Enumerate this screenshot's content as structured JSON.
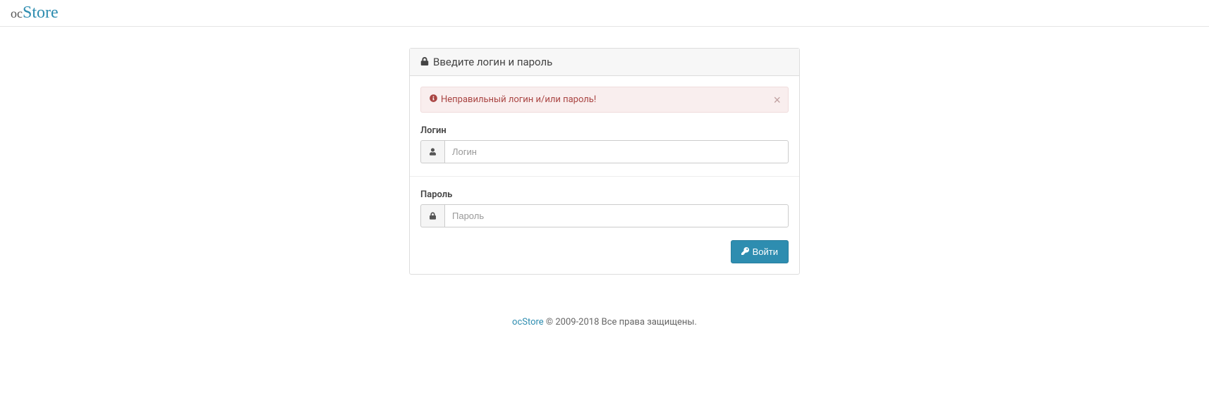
{
  "header": {
    "logo_oc": "oc",
    "logo_store": "Store"
  },
  "panel": {
    "title": "Введите логин и пароль"
  },
  "alert": {
    "message": "Неправильный логин и/или пароль!"
  },
  "form": {
    "login_label": "Логин",
    "login_placeholder": "Логин",
    "login_value": "",
    "password_label": "Пароль",
    "password_placeholder": "Пароль",
    "password_value": "",
    "submit_label": "Войти"
  },
  "footer": {
    "link_text": "ocStore",
    "copyright": " © 2009-2018 Все права защищены."
  }
}
